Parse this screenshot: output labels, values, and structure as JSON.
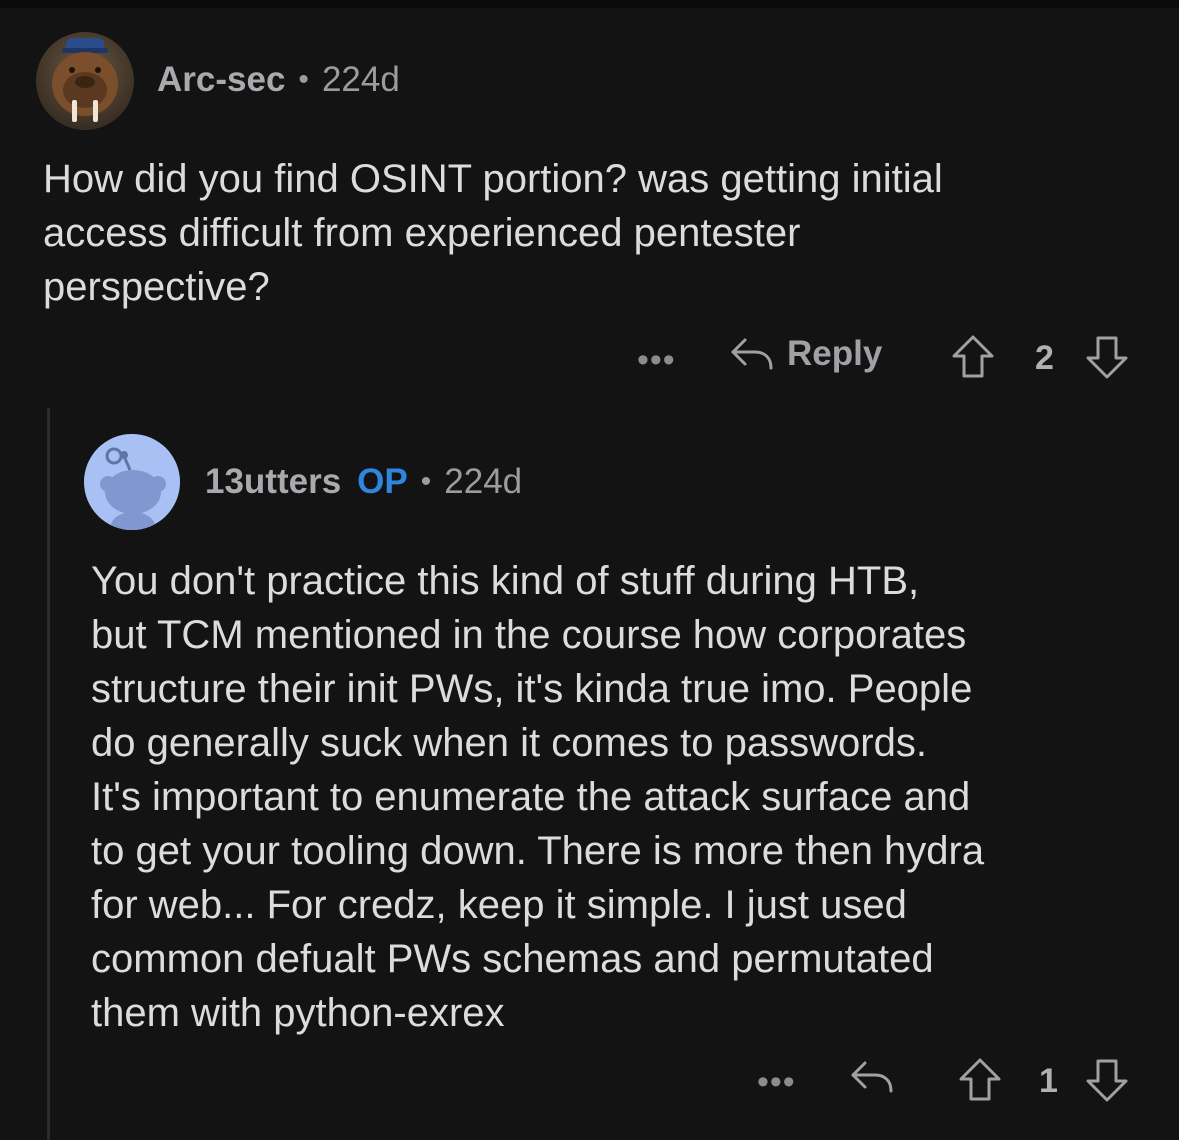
{
  "comments": [
    {
      "username": "Arc-sec",
      "separator": "•",
      "age": "224d",
      "body": "How did you find OSINT portion? was getting initial\naccess difficult from experienced pentester\nperspective?",
      "actions": {
        "more": "•••",
        "reply_label": "Reply",
        "vote_count": "2"
      }
    },
    {
      "username": "13utters",
      "badge": "OP",
      "separator": "•",
      "age": "224d",
      "body": "You don't practice this kind of stuff during HTB,\nbut TCM mentioned in the course how corporates\nstructure their init PWs, it's kinda true imo. People\ndo generally suck when it comes to passwords.\nIt's important to enumerate the attack surface and\nto get your tooling down. There is more then hydra\nfor web... For credz, keep it simple. I just used\ncommon defualt PWs schemas and permutated\nthem with python-exrex",
      "actions": {
        "more": "•••",
        "vote_count": "1"
      }
    }
  ],
  "icons": [
    "walrus-avatar",
    "snoo-avatar",
    "reply-arrow-icon",
    "upvote-arrow-icon",
    "downvote-arrow-icon",
    "more-dots-icon"
  ],
  "colors": {
    "background": "#131313",
    "op_badge": "#2e86de",
    "text": "#dcdcdc",
    "meta": "#9a9ca0"
  }
}
